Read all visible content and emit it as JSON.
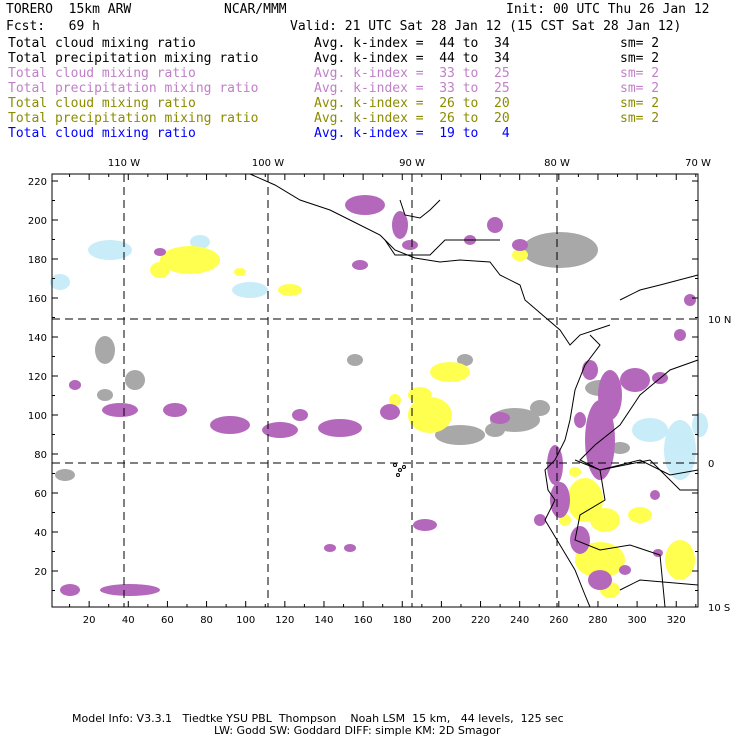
{
  "header": {
    "model": "TORERO  15km ARW",
    "org": "NCAR/MMM",
    "init": "Init: 00 UTC Thu 26 Jan 12",
    "fcst": "Fcst:   69 h",
    "valid": "Valid: 21 UTC Sat 28 Jan 12 (15 CST Sat 28 Jan 12)"
  },
  "legend": [
    {
      "field": "Total cloud mixing ratio",
      "range": "Avg. k-index =  44 to  34",
      "sm": "sm= 2"
    },
    {
      "field": "Total precipitation mixing ratio",
      "range": "Avg. k-index =  44 to  34",
      "sm": "sm= 2"
    },
    {
      "field": "Total cloud mixing ratio",
      "range": "Avg. k-index =  33 to  25",
      "sm": "sm= 2"
    },
    {
      "field": "Total precipitation mixing ratio",
      "range": "Avg. k-index =  33 to  25",
      "sm": "sm= 2"
    },
    {
      "field": "Total cloud mixing ratio",
      "range": "Avg. k-index =  26 to  20",
      "sm": "sm= 2"
    },
    {
      "field": "Total precipitation mixing ratio",
      "range": "Avg. k-index =  26 to  20",
      "sm": "sm= 2"
    },
    {
      "field": "Total cloud mixing ratio",
      "range": "Avg. k-index =  19 to   4"
    }
  ],
  "colors": {
    "gray": "#a8a8a8",
    "purple": "#b468bc",
    "yellow": "#ffff50",
    "lightblue": "#c8ecf8"
  },
  "map": {
    "lon_labels": [
      "110 W",
      "100 W",
      "90 W",
      "80 W",
      "70 W"
    ],
    "lat_labels": [
      "10 N",
      "0",
      "10 S"
    ],
    "x_ticks": [
      "20",
      "40",
      "60",
      "80",
      "100",
      "120",
      "140",
      "160",
      "180",
      "200",
      "220",
      "240",
      "260",
      "280",
      "300",
      "320"
    ],
    "y_ticks": [
      "20",
      "40",
      "60",
      "80",
      "100",
      "120",
      "140",
      "160",
      "180",
      "200",
      "220"
    ]
  },
  "footer": {
    "line1": "Model Info: V3.3.1   Tiedtke YSU PBL  Thompson    Noah LSM  15 km,   44 levels,  125 sec",
    "line2": "LW: Godd SW: Goddard DIFF: simple KM: 2D Smagor"
  }
}
